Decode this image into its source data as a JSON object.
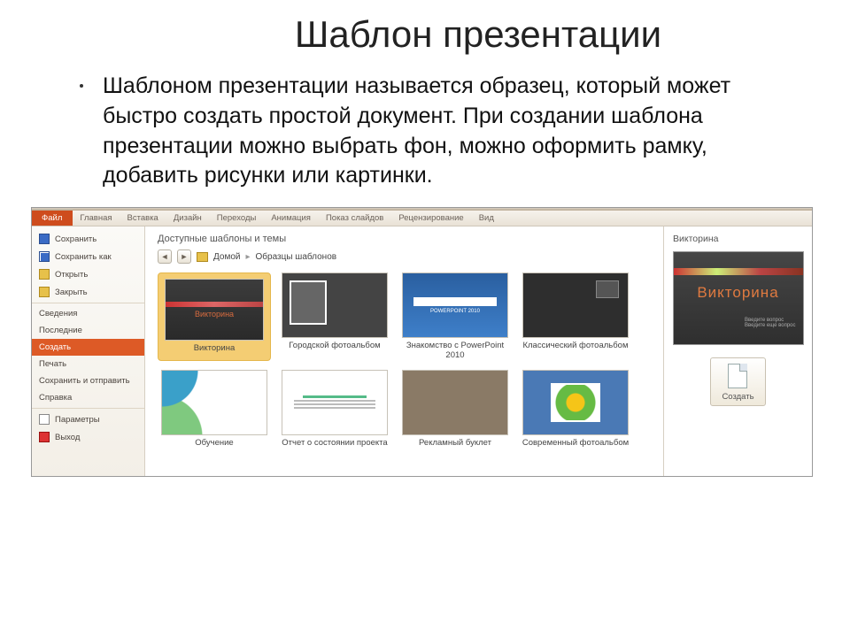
{
  "slide": {
    "title": "Шаблон презентации",
    "body": "Шаблоном презентации называется образец, который может быстро создать простой документ. При создании шаблона презентации можно выбрать фон, можно оформить рамку, добавить рисунки или картинки."
  },
  "ribbon": {
    "file": "Файл",
    "tabs": [
      "Главная",
      "Вставка",
      "Дизайн",
      "Переходы",
      "Анимация",
      "Показ слайдов",
      "Рецензирование",
      "Вид"
    ]
  },
  "nav": {
    "save": "Сохранить",
    "save_as": "Сохранить как",
    "open": "Открыть",
    "close": "Закрыть",
    "info": "Сведения",
    "recent": "Последние",
    "create": "Создать",
    "print": "Печать",
    "share": "Сохранить и отправить",
    "help": "Справка",
    "options": "Параметры",
    "exit": "Выход"
  },
  "center": {
    "heading": "Доступные шаблоны и темы",
    "breadcrumb_home": "Домой",
    "breadcrumb_current": "Образцы шаблонов",
    "items": [
      "Викторина",
      "Городской фотоальбом",
      "Знакомство с PowerPoint 2010",
      "Классический фотоальбом",
      "Обучение",
      "Отчет о состоянии проекта",
      "Рекламный буклет",
      "Современный фотоальбом"
    ]
  },
  "right": {
    "title": "Викторина",
    "preview_text": "Викторина",
    "create": "Создать"
  }
}
